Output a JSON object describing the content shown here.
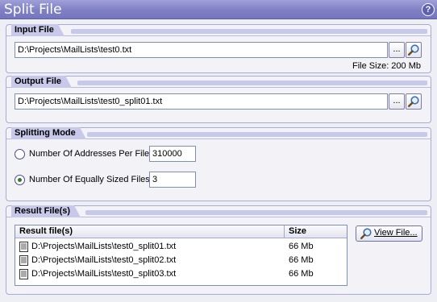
{
  "window": {
    "title": "Split File",
    "help_label": "?"
  },
  "input": {
    "heading": "Input File",
    "path": "D:\\Projects\\MailLists\\test0.txt",
    "browse_label": "...",
    "file_size": "File Size: 200 Mb"
  },
  "output": {
    "heading": "Output File",
    "path": "D:\\Projects\\MailLists\\test0_split01.txt",
    "browse_label": "..."
  },
  "mode": {
    "heading": "Splitting Mode",
    "options": [
      {
        "label": "Number Of Addresses Per File",
        "value": "310000",
        "selected": false
      },
      {
        "label": "Number Of Equally Sized Files",
        "value": "3",
        "selected": true
      }
    ]
  },
  "results": {
    "heading": "Result File(s)",
    "columns": [
      "Result file(s)",
      "Size"
    ],
    "rows": [
      {
        "file": "D:\\Projects\\MailLists\\test0_split01.txt",
        "size": "66 Mb"
      },
      {
        "file": "D:\\Projects\\MailLists\\test0_split02.txt",
        "size": "66 Mb"
      },
      {
        "file": "D:\\Projects\\MailLists\\test0_split03.txt",
        "size": "66 Mb"
      }
    ],
    "view_button": "View File..."
  },
  "icons": {
    "browse": "ellipsis-icon",
    "find": "magnifier-icon",
    "file": "document-icon",
    "help": "help-icon"
  },
  "colors": {
    "titlebar": "#7f80c4",
    "group_header": "#c8c9ea",
    "background": "#eeeef5"
  }
}
